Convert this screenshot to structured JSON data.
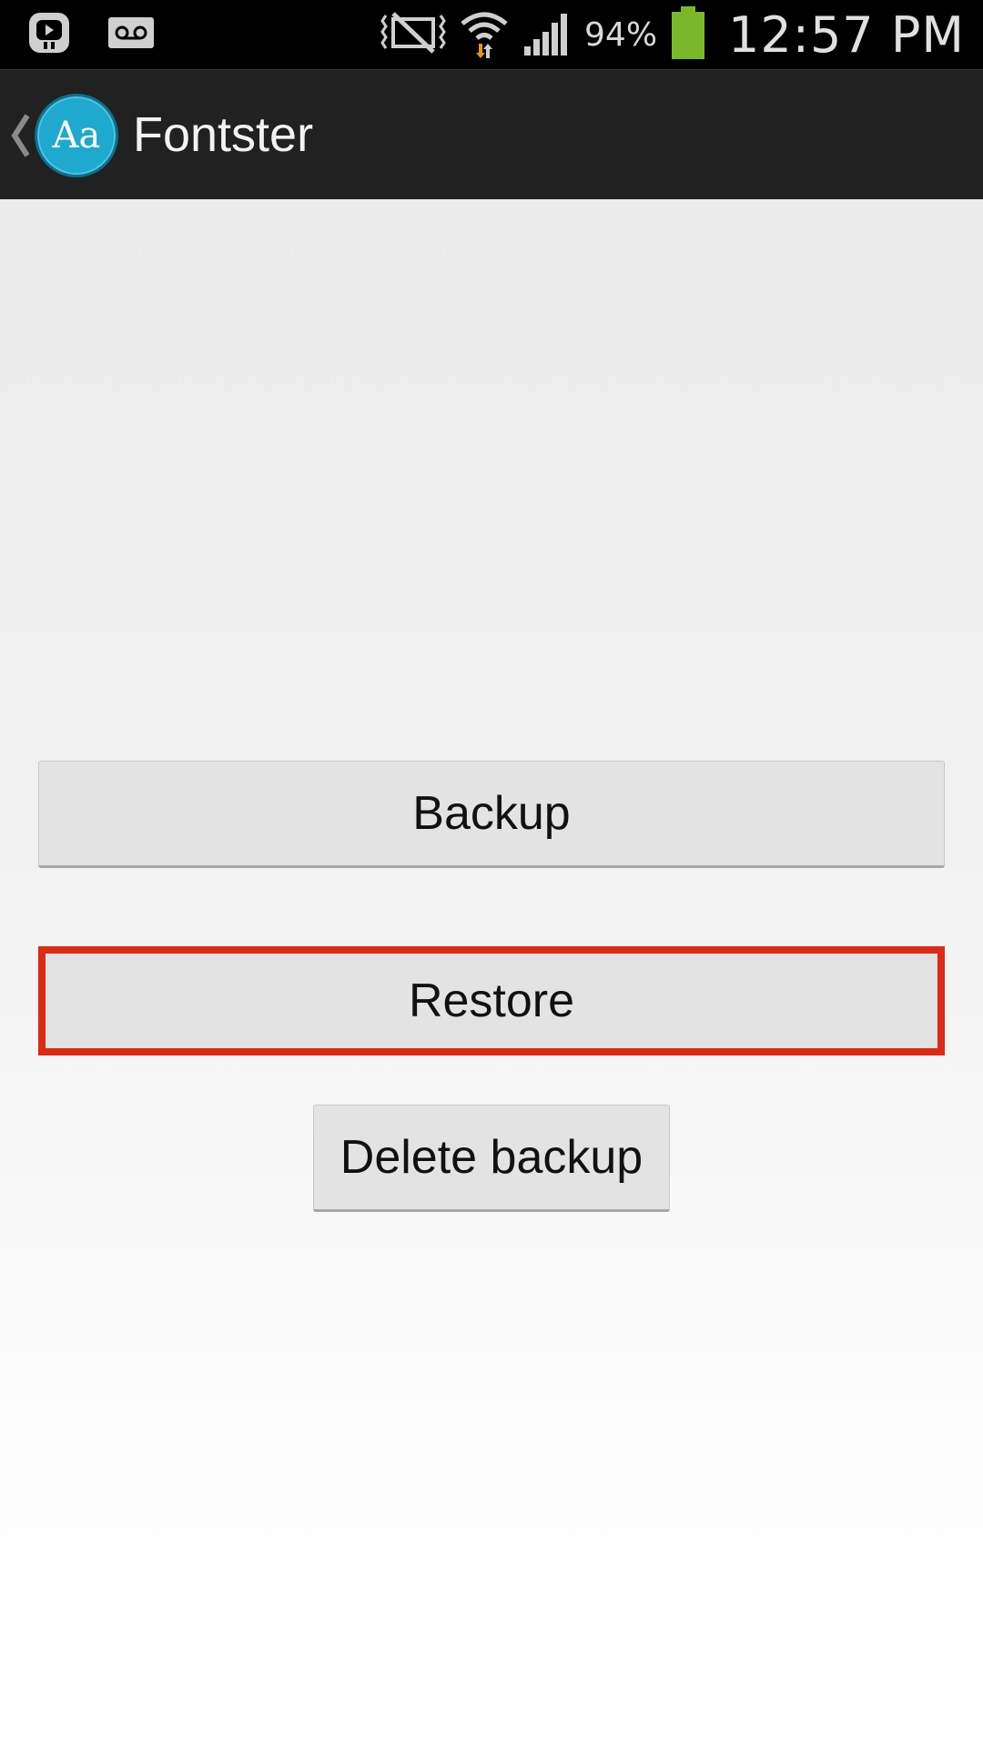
{
  "status_bar": {
    "battery_percent": "94%",
    "time": "12:57 PM",
    "left_icons": [
      "notification-app-icon",
      "voicemail-icon"
    ],
    "right_icons": [
      "nfc-off-icon",
      "wifi-icon",
      "signal-icon",
      "battery-icon"
    ],
    "battery_level": 0.94
  },
  "action_bar": {
    "title": "Fontster",
    "logo_text": "Aa"
  },
  "main": {
    "backup_label": "Backup",
    "restore_label": "Restore",
    "delete_backup_label": "Delete backup"
  },
  "colors": {
    "highlight": "#dd2a13",
    "logo": "#1fa9cf",
    "battery": "#7bb829"
  }
}
